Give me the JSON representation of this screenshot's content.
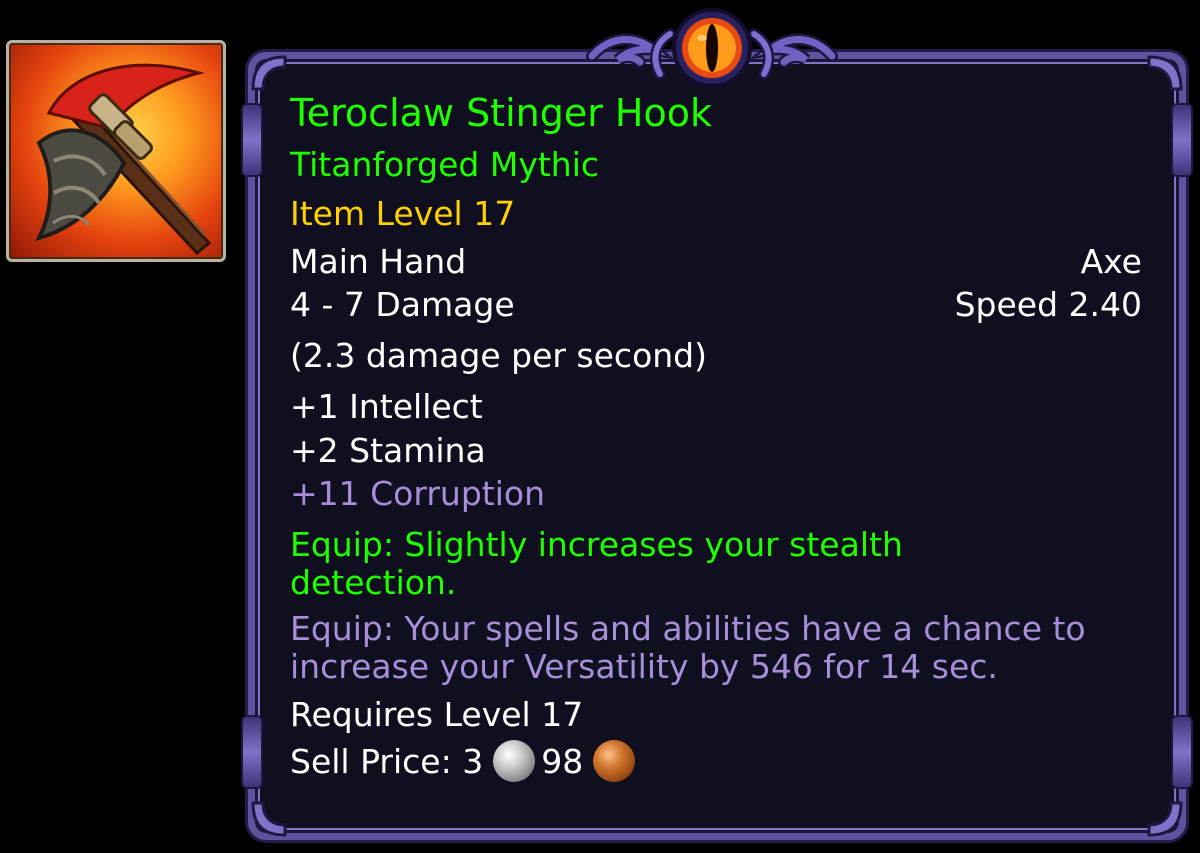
{
  "item": {
    "icon": "battle-axe-icon",
    "name": "Teroclaw Stinger Hook",
    "quality": "Titanforged Mythic",
    "item_level": "Item Level 17",
    "slot": "Main Hand",
    "weapon_type": "Axe",
    "damage": "4 - 7 Damage",
    "speed": "Speed 2.40",
    "dps": "(2.3 damage per second)",
    "stats": [
      "+1 Intellect",
      "+2 Stamina"
    ],
    "corruption": "+11 Corruption",
    "equip_effects": [
      "Equip: Slightly increases your stealth detection.",
      "Equip: Your spells and abilities have a chance to increase your Versatility by 546 for 14 sec."
    ],
    "requirement": "Requires Level 17",
    "sell_price": {
      "label": "Sell Price:",
      "silver": "3",
      "copper": "98",
      "silver_icon": "silver-coin-icon",
      "copper_icon": "copper-coin-icon"
    }
  },
  "colors": {
    "name": "#1eff00",
    "item_level": "#ffd100",
    "corruption": "#a68ed8",
    "text": "#ffffff",
    "frame": "#5e539e",
    "background": "#0f0f1f"
  }
}
